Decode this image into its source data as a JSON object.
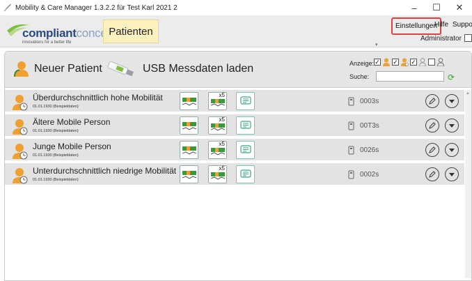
{
  "window": {
    "title": "Mobility & Care Manager 1.3.2.2 für Test Karl 2021 2",
    "controls": {
      "minimize": "–",
      "maximize": "☐",
      "close": "✕"
    }
  },
  "header": {
    "brand_bold": "compliant",
    "brand_light": "concept",
    "tagline": "innovations for a better life",
    "tab_label": "Patienten",
    "menu": {
      "einstellungen": "Einstellungen",
      "hilfe": "Hilfe",
      "support": "Suppor"
    },
    "user": "Administrator"
  },
  "toolbar": {
    "new_patient": "Neuer Patient",
    "usb_load": "USB Messdaten laden",
    "anzeige_label": "Anzeige:",
    "suche_label": "Suche:",
    "search_value": "",
    "filters": [
      {
        "checked": true,
        "icon": "person-orange-icon"
      },
      {
        "checked": true,
        "icon": "person-orange-clock-icon"
      },
      {
        "checked": true,
        "icon": "person-outline-icon"
      },
      {
        "checked": false,
        "icon": "person-gray-icon"
      }
    ]
  },
  "patients": [
    {
      "name": "Überdurchschnittlich hohe Mobilität",
      "sub": "01.01.1930 (Beispieldaten)",
      "x5": "x5",
      "sensor": "0003s"
    },
    {
      "name": "Ältere Mobile Person",
      "sub": "01.01.1930 (Beispieldaten)",
      "x5": "x5",
      "sensor": "00T3s"
    },
    {
      "name": "Junge Mobile Person",
      "sub": "01.01.1930 (Beispieldaten)",
      "x5": "x5",
      "sensor": "0026s"
    },
    {
      "name": "Unterdurchschnittlich niedrige Mobilität",
      "sub": "01.01.1930 (Beispieldaten)",
      "x5": "x5",
      "sensor": "0002s"
    }
  ],
  "colors": {
    "accent_orange": "#f0a030",
    "highlight_red": "#e04040",
    "tab_yellow": "#fdf2bf",
    "brand_blue": "#2a4a86"
  }
}
